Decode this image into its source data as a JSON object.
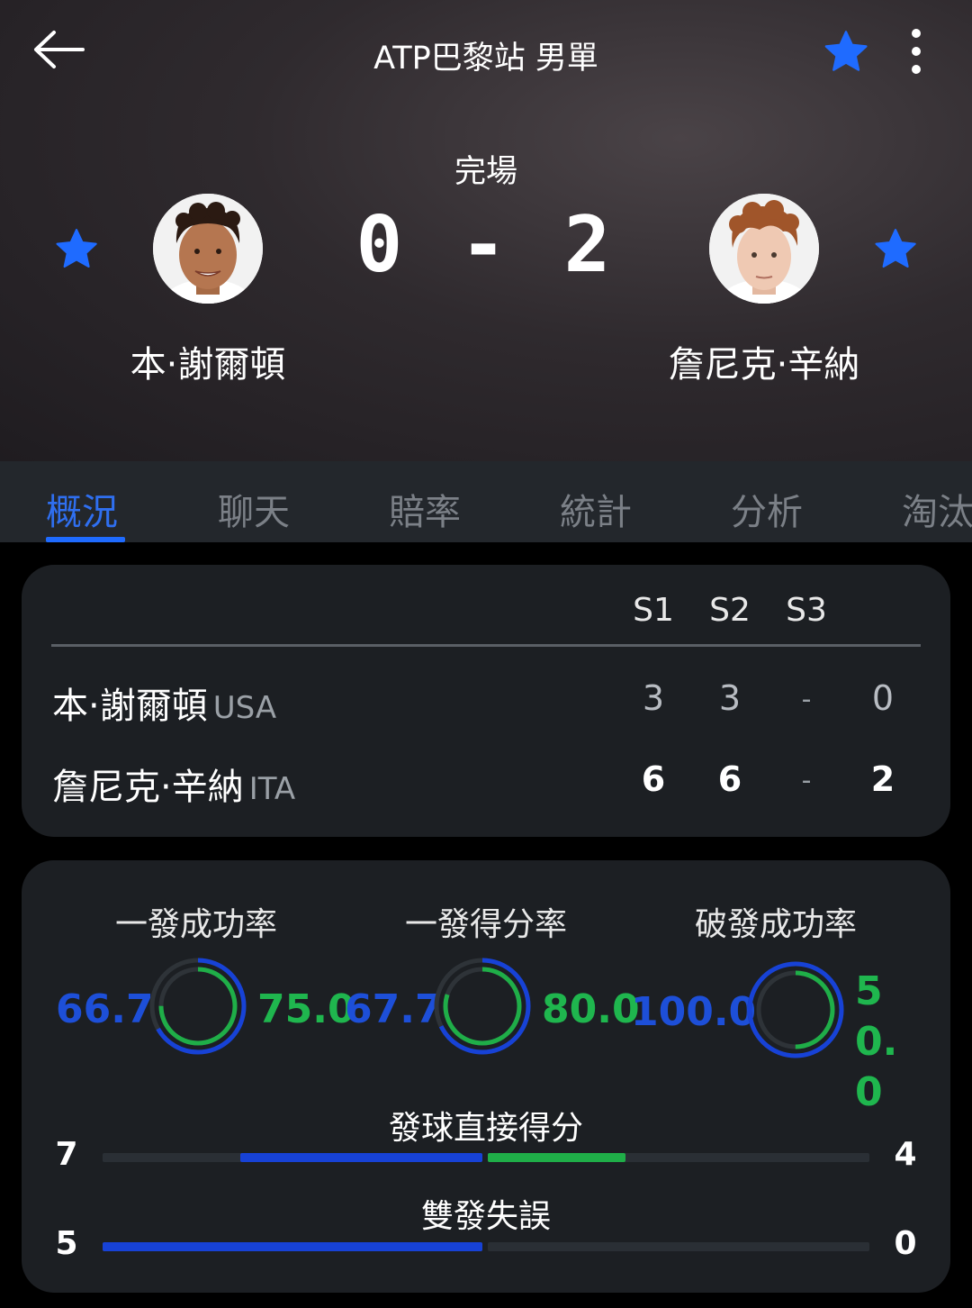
{
  "header": {
    "title": "ATP巴黎站 男單",
    "status": "完場",
    "score": "0 - 2"
  },
  "players": [
    {
      "name": "本·謝爾頓",
      "country": "USA"
    },
    {
      "name": "詹尼克·辛納",
      "country": "ITA"
    }
  ],
  "tabs": [
    "概況",
    "聊天",
    "賠率",
    "統計",
    "分析",
    "淘汰"
  ],
  "active_tab": 0,
  "scoreboard": {
    "sets": [
      "S1",
      "S2",
      "S3"
    ],
    "rows": [
      {
        "s1": "3",
        "s2": "3",
        "s3": "-",
        "total": "0"
      },
      {
        "s1": "6",
        "s2": "6",
        "s3": "-",
        "total": "2"
      }
    ]
  },
  "stats": [
    {
      "title": "一發成功率",
      "left": "66.7",
      "right": "75.0",
      "left_value": 66.7,
      "right_value": 75.0
    },
    {
      "title": "一發得分率",
      "left": "67.7",
      "right": "80.0",
      "left_value": 67.7,
      "right_value": 80.0
    },
    {
      "title": "破發成功率",
      "left": "100.0",
      "right": "50.0",
      "left_value": 100.0,
      "right_value": 50.0
    }
  ],
  "bars": [
    {
      "title": "發球直接得分",
      "left": "7",
      "right": "4",
      "left_value": 7,
      "right_value": 4
    },
    {
      "title": "雙發失誤",
      "left": "5",
      "right": "0",
      "left_value": 5,
      "right_value": 0
    }
  ],
  "colors": {
    "accent": "#1f6bff",
    "player1": "#1742d6",
    "player2": "#1fae48",
    "card": "#1c1f23"
  },
  "icons": {
    "back": "arrow-left-icon",
    "favorite": "star-icon",
    "more": "more-vertical-icon"
  }
}
